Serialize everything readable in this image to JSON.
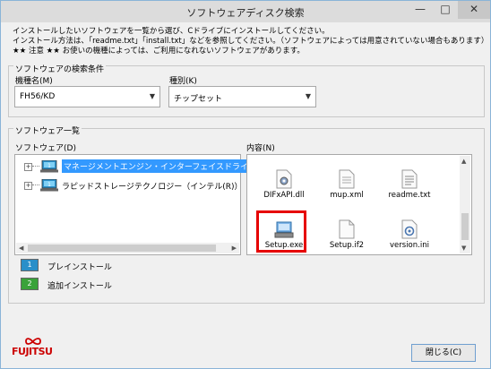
{
  "window": {
    "title": "ソフトウェアディスク検索",
    "min_glyph": "—",
    "max_glyph": "□",
    "close_glyph": "✕"
  },
  "instructions": [
    "インストールしたいソフトウェアを一覧から選び、Cドライブにインストールしてください。",
    "インストール方法は、「readme.txt」「install.txt」などを参照してください。（ソフトウェアによっては用意されていない場合もあります）",
    "★★ 注意 ★★ お使いの機種によっては、ご利用になれないソフトウェアがあります。"
  ],
  "search": {
    "group_label": "ソフトウェアの検索条件",
    "model_label": "機種名(M)",
    "model_value": "FH56/KD",
    "type_label": "種別(K)",
    "type_value": "チップセット"
  },
  "list": {
    "group_label": "ソフトウェア一覧",
    "software_label": "ソフトウェア(D)",
    "contents_label": "内容(N)",
    "tree": [
      {
        "label": "マネージメントエンジン・インターフェイスドライバー（イン",
        "selected": true
      },
      {
        "label": "ラピッドストレージテクノロジー（インテル(R)）",
        "selected": false
      }
    ],
    "files": [
      {
        "name": "DIFxAPI.dll",
        "icon": "dll-file-icon"
      },
      {
        "name": "mup.xml",
        "icon": "xml-file-icon"
      },
      {
        "name": "readme.txt",
        "icon": "text-file-icon"
      },
      {
        "name": "Setup.exe",
        "icon": "setup-exe-icon"
      },
      {
        "name": "Setup.if2",
        "icon": "blank-file-icon"
      },
      {
        "name": "version.ini",
        "icon": "ini-file-icon"
      }
    ]
  },
  "legend": [
    {
      "number": "1",
      "label": "プレインストール",
      "color": "#2a8fc9"
    },
    {
      "number": "2",
      "label": "追加インストール",
      "color": "#3aa23a"
    }
  ],
  "brand": {
    "name": "FUJITSU",
    "color": "#cc0000"
  },
  "footer": {
    "close_label": "閉じる(C)"
  },
  "colors": {
    "selection": "#3399ff",
    "highlight_border": "#e60000",
    "button_border": "#6f9fd0"
  }
}
